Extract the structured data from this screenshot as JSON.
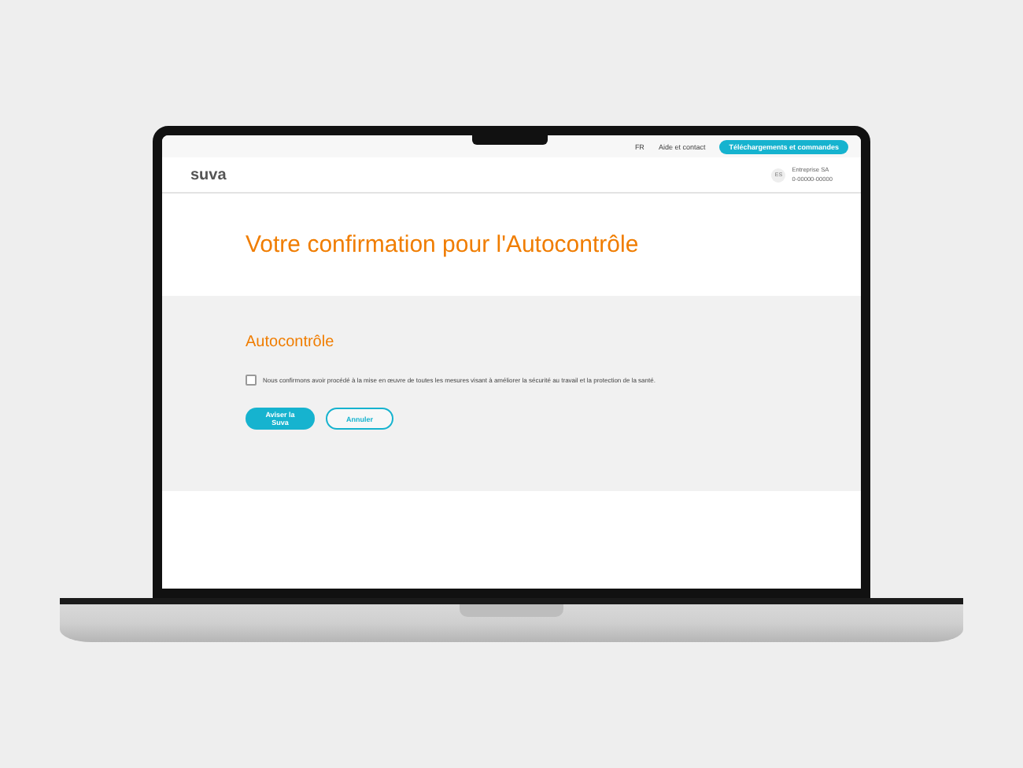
{
  "top_bar": {
    "language": "FR",
    "help_link": "Aide et contact",
    "downloads_button": "Téléchargements et commandes"
  },
  "header": {
    "logo": "suva",
    "account_initials": "ES",
    "account_name": "Entreprise SA",
    "account_number": "0-00000-00000"
  },
  "title": "Votre confirmation pour l'Autocontrôle",
  "section": {
    "heading": "Autocontrôle",
    "checkbox": {
      "label": "Nous confirmons avoir procédé à la mise en œuvre de toutes les mesures visant à améliorer la sécurité au travail et la protection de la santé.",
      "checked": false
    },
    "buttons": [
      {
        "label": "Aviser la Suva",
        "kind": "primary"
      },
      {
        "label": "Annuler",
        "kind": "secondary"
      }
    ]
  }
}
